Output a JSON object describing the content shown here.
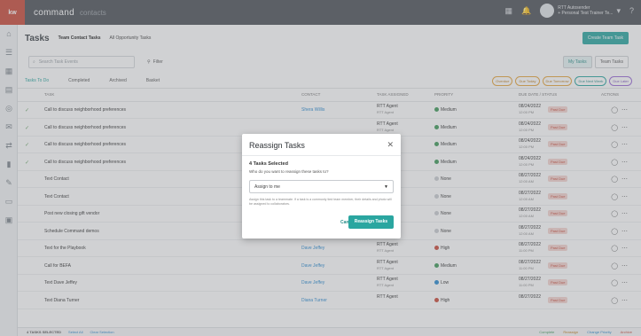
{
  "app": {
    "badge": "kw",
    "brand": "command",
    "brand_sub": "contacts"
  },
  "topbar": {
    "user_name": "RTT Autosender",
    "user_sub": "+ Personal Test Trainer Te..."
  },
  "page": {
    "title": "Tasks",
    "links": [
      "Team Contact Tasks",
      "All Opportunity Tasks"
    ],
    "create_button": "Create Team Task"
  },
  "filters": {
    "search_placeholder": "Search Task Events",
    "filter_label": "Filter",
    "view_my": "My Tasks",
    "view_team": "Team Tasks"
  },
  "tabs": [
    "Tasks To Do",
    "Completed",
    "Archived",
    "Basket"
  ],
  "chips": [
    "Overdue",
    "Due Today",
    "Due Tomorrow",
    "Due Next Week",
    "Due Later"
  ],
  "table": {
    "headers": [
      "Task",
      "Contact",
      "Task Assigned",
      "Priority",
      "Due Date / Status",
      "Actions"
    ],
    "rows": [
      {
        "task": "Call to discuss neighborhood preferences",
        "contact": "Shera Willis",
        "assigned": "RTT Agent",
        "assigned_sub": "RTT Agent",
        "priority": "Medium",
        "prio_color": "#3f9a5a",
        "due": "08/24/2022",
        "due_sub": "12:00 PM",
        "status": "Past Due",
        "checked": true
      },
      {
        "task": "Call to discuss neighborhood preferences",
        "contact": "",
        "assigned": "RTT Agent",
        "assigned_sub": "RTT Agent",
        "priority": "Medium",
        "prio_color": "#3f9a5a",
        "due": "08/24/2022",
        "due_sub": "12:00 PM",
        "status": "Past Due",
        "checked": true
      },
      {
        "task": "Call to discuss neighborhood preferences",
        "contact": "",
        "assigned": "RTT Agent",
        "assigned_sub": "RTT Agent",
        "priority": "Medium",
        "prio_color": "#3f9a5a",
        "due": "08/24/2022",
        "due_sub": "12:00 PM",
        "status": "Past Due",
        "checked": true
      },
      {
        "task": "Call to discuss neighborhood preferences",
        "contact": "",
        "assigned": "RTT Agent",
        "assigned_sub": "RTT Agent",
        "priority": "Medium",
        "prio_color": "#3f9a5a",
        "due": "08/24/2022",
        "due_sub": "12:00 PM",
        "status": "Past Due",
        "checked": true
      },
      {
        "task": "Text Contact",
        "contact": "",
        "assigned": "RTT Agent",
        "assigned_sub": "RTT Agent",
        "priority": "None",
        "prio_color": "#c9cdd1",
        "due": "08/27/2022",
        "due_sub": "12:00 AM",
        "status": "Past Due",
        "checked": false
      },
      {
        "task": "Text Contact",
        "contact": "",
        "assigned": "RTT Agent",
        "assigned_sub": "RTT Agent",
        "priority": "None",
        "prio_color": "#c9cdd1",
        "due": "08/27/2022",
        "due_sub": "12:00 AM",
        "status": "Past Due",
        "checked": false
      },
      {
        "task": "Post new closing gift vendor",
        "contact": "",
        "assigned": "RTT Agent",
        "assigned_sub": "RTT Agent",
        "priority": "None",
        "prio_color": "#c9cdd1",
        "due": "08/27/2022",
        "due_sub": "12:00 AM",
        "status": "Past Due",
        "checked": false
      },
      {
        "task": "Schedule Command demos",
        "contact": "",
        "assigned": "RTT Agent",
        "assigned_sub": "RTT Agent",
        "priority": "None",
        "prio_color": "#c9cdd1",
        "due": "08/27/2022",
        "due_sub": "12:00 AM",
        "status": "Past Due",
        "checked": false
      },
      {
        "task": "Text for the Playbook",
        "contact": "Dave Jeffey",
        "assigned": "RTT Agent",
        "assigned_sub": "RTT Agent",
        "priority": "High",
        "prio_color": "#c94a3a",
        "due": "08/27/2022",
        "due_sub": "11:00 PM",
        "status": "Past Due",
        "checked": false
      },
      {
        "task": "Call for BEFA",
        "contact": "Dave Jeffey",
        "assigned": "RTT Agent",
        "assigned_sub": "RTT Agent",
        "priority": "Medium",
        "prio_color": "#3f9a5a",
        "due": "08/27/2022",
        "due_sub": "11:00 PM",
        "status": "Past Due",
        "checked": false
      },
      {
        "task": "Text Dave Jeffey",
        "contact": "Dave Jeffey",
        "assigned": "RTT Agent",
        "assigned_sub": "RTT Agent",
        "priority": "Low",
        "prio_color": "#2a8ad0",
        "due": "08/27/2022",
        "due_sub": "11:00 PM",
        "status": "Past Due",
        "checked": false
      },
      {
        "task": "Text Diana Turner",
        "contact": "Diana Turner",
        "assigned": "RTT Agent",
        "assigned_sub": "",
        "priority": "High",
        "prio_color": "#c94a3a",
        "due": "08/27/2022",
        "due_sub": "",
        "status": "Past Due",
        "checked": false
      }
    ]
  },
  "footer": {
    "selected": "4 TASKS SELECTED",
    "select_all": "Select All",
    "clear": "Clear Selection",
    "actions": [
      "Complete",
      "Reassign",
      "Change Priority",
      "Archive"
    ]
  },
  "modal": {
    "title": "Reassign Tasks",
    "count": "4 Tasks Selected",
    "question": "Who do you want to reassign these tasks to?",
    "select_value": "Assign to me",
    "hint": "Assign this task to a teammate. If a task is a commonly tied team member, their details and photo will be assigned to collaborators.",
    "cancel": "Cancel",
    "submit": "Reassign Tasks"
  }
}
